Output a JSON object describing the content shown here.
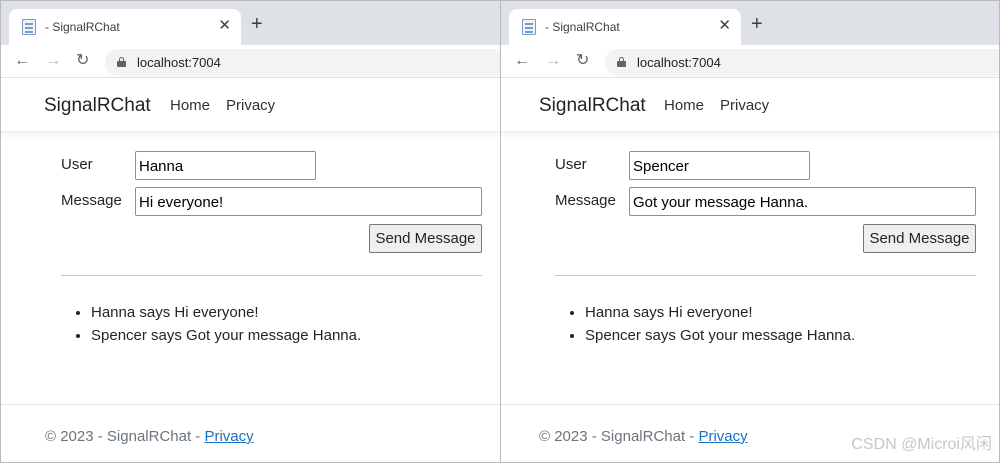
{
  "windows": [
    {
      "tab": {
        "title": "- SignalRChat",
        "close": "✕",
        "new_tab": "+"
      },
      "address": {
        "url": "localhost:7004"
      },
      "navbar": {
        "brand": "SignalRChat",
        "links": [
          "Home",
          "Privacy"
        ]
      },
      "form": {
        "user_label": "User",
        "user_value": "Hanna",
        "message_label": "Message",
        "message_value": "Hi everyone!",
        "send_label": "Send Message"
      },
      "messages": [
        "Hanna says Hi everyone!",
        "Spencer says Got your message Hanna."
      ],
      "footer": {
        "text": "© 2023 - SignalRChat - ",
        "link": "Privacy"
      }
    },
    {
      "tab": {
        "title": "- SignalRChat",
        "close": "✕",
        "new_tab": "+"
      },
      "address": {
        "url": "localhost:7004"
      },
      "navbar": {
        "brand": "SignalRChat",
        "links": [
          "Home",
          "Privacy"
        ]
      },
      "form": {
        "user_label": "User",
        "user_value": "Spencer",
        "message_label": "Message",
        "message_value": "Got your message Hanna.",
        "send_label": "Send Message"
      },
      "messages": [
        "Hanna says Hi everyone!",
        "Spencer says Got your message Hanna."
      ],
      "footer": {
        "text": "© 2023 - SignalRChat - ",
        "link": "Privacy"
      }
    }
  ],
  "watermark": "CSDN @Microi风闲",
  "icons": {
    "back": "arrow-left-icon",
    "forward": "arrow-right-icon",
    "reload": "reload-icon",
    "lock": "lock-icon",
    "favicon": "page-favicon-icon"
  },
  "colors": {
    "link": "#1b6ec2",
    "tabstrip": "#dee1e6",
    "footer_text": "#6c757d"
  }
}
